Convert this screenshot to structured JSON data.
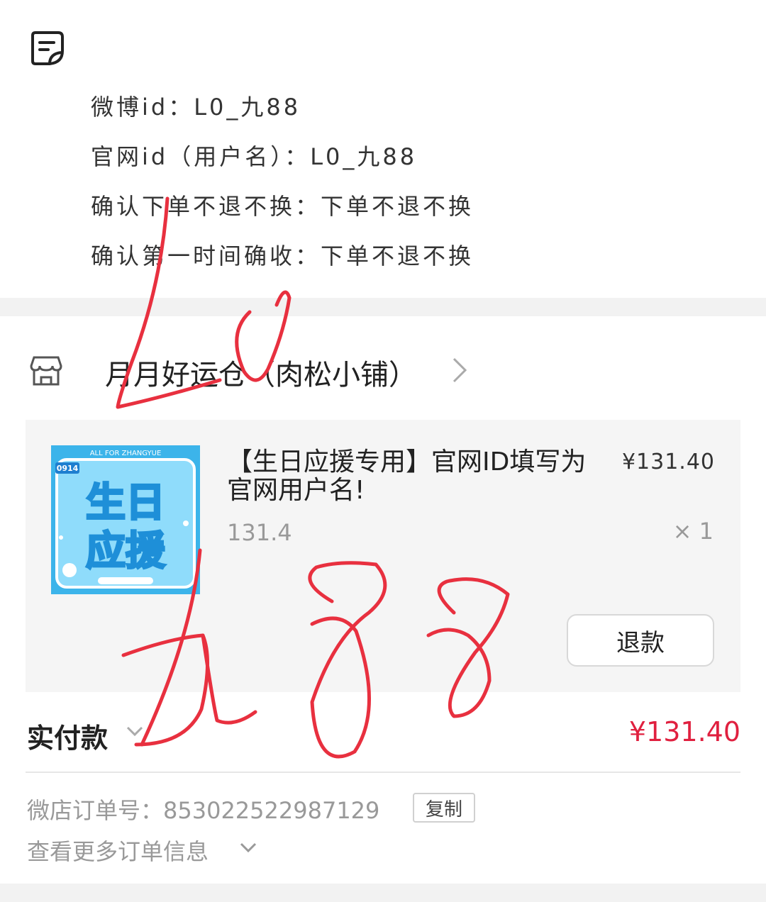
{
  "note": {
    "lines": [
      "微博id：L0_九88",
      "官网id（用户名）：L0_九88",
      "确认下单不退不换：下单不退不换",
      "确认第一时间确收：下单不退不换"
    ]
  },
  "store": {
    "name": "月月好运仓（肉松小铺）"
  },
  "product": {
    "title": "【生日应援专用】官网ID填写为官网用户名!",
    "price": "¥131.40",
    "spec": "131.4",
    "quantity": "× 1",
    "refund_label": "退款",
    "thumbnail": {
      "banner": "ALL FOR ZHANGYUE",
      "badge": "0914",
      "line1": "生日",
      "line2": "应援"
    }
  },
  "payment": {
    "label": "实付款",
    "amount": "¥131.40"
  },
  "order": {
    "number_label": "微店订单号：853022522987129",
    "copy_label": "复制",
    "more_info": "查看更多订单信息"
  },
  "colors": {
    "accent_red": "#e0203f",
    "handwriting": "#e8303f",
    "thumb_blue": "#3cb4ea"
  }
}
